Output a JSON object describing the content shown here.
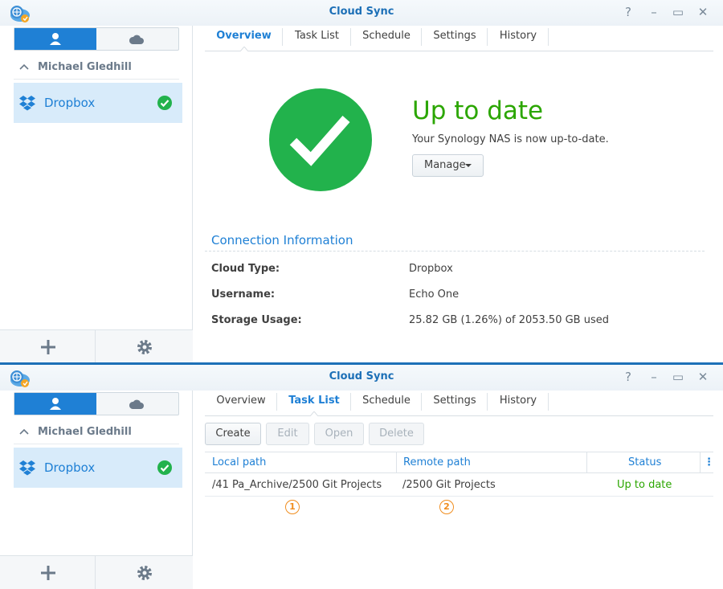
{
  "app": {
    "title": "Cloud Sync"
  },
  "window_controls": {
    "help": "?",
    "minimize": "–",
    "maximize": "▭",
    "close": "✕"
  },
  "sidebar": {
    "account_owner": "Michael Gledhill",
    "connection": {
      "name": "Dropbox",
      "status": "ok"
    }
  },
  "tabs": [
    "Overview",
    "Task List",
    "Schedule",
    "Settings",
    "History"
  ],
  "overview": {
    "status_title": "Up to date",
    "status_subtitle": "Your Synology NAS is now up-to-date.",
    "manage_label": "Manage",
    "connection_section_title": "Connection Information",
    "info": [
      {
        "label": "Cloud Type:",
        "value": "Dropbox"
      },
      {
        "label": "Username:",
        "value": "Echo One"
      },
      {
        "label": "Storage Usage:",
        "value": "25.82 GB (1.26%) of 2053.50 GB used"
      }
    ]
  },
  "task_list": {
    "buttons": [
      {
        "label": "Create",
        "enabled": true
      },
      {
        "label": "Edit",
        "enabled": false
      },
      {
        "label": "Open",
        "enabled": false
      },
      {
        "label": "Delete",
        "enabled": false
      }
    ],
    "columns": [
      "Local path",
      "Remote path",
      "Status"
    ],
    "rows": [
      {
        "local": "/41 Pa_Archive/2500 Git Projects",
        "remote": "/2500 Git Projects",
        "status": "Up to date"
      }
    ],
    "markers": [
      "1",
      "2"
    ]
  },
  "colors": {
    "accent": "#1f80d5",
    "success": "#22b24c",
    "success_text": "#2ba600",
    "marker": "#f08c1c"
  }
}
